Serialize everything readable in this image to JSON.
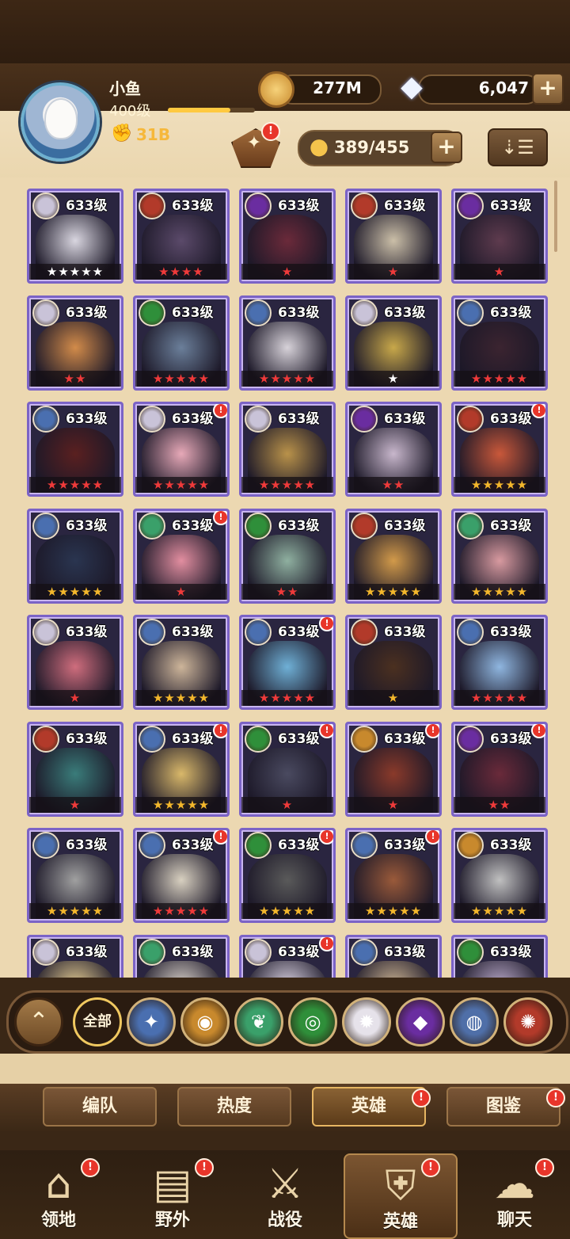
{
  "player": {
    "name": "小鱼",
    "level": "400级",
    "power": "31B"
  },
  "currency": {
    "gold": "277M",
    "gems": "6,047"
  },
  "hero_count": "389/455",
  "heroes": [
    {
      "level": "633级",
      "stars": "★★★★★",
      "star_color": "#ffffff",
      "faction_color": "#c9c3d8",
      "alert": false
    },
    {
      "level": "633级",
      "stars": "★★★★",
      "star_color": "#ef3a3a",
      "faction_color": "#b23a2a",
      "alert": false
    },
    {
      "level": "633级",
      "stars": "★",
      "star_color": "#ef3a3a",
      "faction_color": "#6a2da0",
      "alert": false
    },
    {
      "level": "633级",
      "stars": "★",
      "star_color": "#ef3a3a",
      "faction_color": "#b23a2a",
      "alert": false
    },
    {
      "level": "633级",
      "stars": "★",
      "star_color": "#ef3a3a",
      "faction_color": "#6a2da0",
      "alert": false
    },
    {
      "level": "633级",
      "stars": "★★",
      "star_color": "#ef3a3a",
      "faction_color": "#c9c3d8",
      "alert": false
    },
    {
      "level": "633级",
      "stars": "★★★★★",
      "star_color": "#ef3a3a",
      "faction_color": "#2f8f3a",
      "alert": false
    },
    {
      "level": "633级",
      "stars": "★★★★★",
      "star_color": "#ef3a3a",
      "faction_color": "#4a6fb0",
      "alert": false
    },
    {
      "level": "633级",
      "stars": "★",
      "star_color": "#ffffff",
      "faction_color": "#c9c3d8",
      "alert": false
    },
    {
      "level": "633级",
      "stars": "★★★★★",
      "star_color": "#ef3a3a",
      "faction_color": "#4a6fb0",
      "alert": false
    },
    {
      "level": "633级",
      "stars": "★★★★★",
      "star_color": "#ef3a3a",
      "faction_color": "#4a6fb0",
      "alert": false
    },
    {
      "level": "633级",
      "stars": "★★★★★",
      "star_color": "#ef3a3a",
      "faction_color": "#c9c3d8",
      "alert": true
    },
    {
      "level": "633级",
      "stars": "★★★★★",
      "star_color": "#ef3a3a",
      "faction_color": "#c9c3d8",
      "alert": false
    },
    {
      "level": "633级",
      "stars": "★★",
      "star_color": "#ef3a3a",
      "faction_color": "#6a2da0",
      "alert": false
    },
    {
      "level": "633级",
      "stars": "★★★★★",
      "star_color": "#f3b72c",
      "faction_color": "#b23a2a",
      "alert": true
    },
    {
      "level": "633级",
      "stars": "★★★★★",
      "star_color": "#f3b72c",
      "faction_color": "#4a6fb0",
      "alert": false
    },
    {
      "level": "633级",
      "stars": "★",
      "star_color": "#ef3a3a",
      "faction_color": "#3aa06a",
      "alert": true
    },
    {
      "level": "633级",
      "stars": "★★",
      "star_color": "#ef3a3a",
      "faction_color": "#2f8f3a",
      "alert": false
    },
    {
      "level": "633级",
      "stars": "★★★★★",
      "star_color": "#f3b72c",
      "faction_color": "#b23a2a",
      "alert": false
    },
    {
      "level": "633级",
      "stars": "★★★★★",
      "star_color": "#f3b72c",
      "faction_color": "#3aa06a",
      "alert": false
    },
    {
      "level": "633级",
      "stars": "★",
      "star_color": "#ef3a3a",
      "faction_color": "#c9c3d8",
      "alert": false
    },
    {
      "level": "633级",
      "stars": "★★★★★",
      "star_color": "#f3b72c",
      "faction_color": "#4a6fb0",
      "alert": false
    },
    {
      "level": "633级",
      "stars": "★★★★★",
      "star_color": "#ef3a3a",
      "faction_color": "#4a6fb0",
      "alert": true
    },
    {
      "level": "633级",
      "stars": "★",
      "star_color": "#f3b72c",
      "faction_color": "#b23a2a",
      "alert": false
    },
    {
      "level": "633级",
      "stars": "★★★★★",
      "star_color": "#ef3a3a",
      "faction_color": "#4a6fb0",
      "alert": false
    },
    {
      "level": "633级",
      "stars": "★",
      "star_color": "#ef3a3a",
      "faction_color": "#b23a2a",
      "alert": false
    },
    {
      "level": "633级",
      "stars": "★★★★★",
      "star_color": "#f3b72c",
      "faction_color": "#4a6fb0",
      "alert": true
    },
    {
      "level": "633级",
      "stars": "★",
      "star_color": "#ef3a3a",
      "faction_color": "#2f8f3a",
      "alert": true
    },
    {
      "level": "633级",
      "stars": "★",
      "star_color": "#ef3a3a",
      "faction_color": "#c8892d",
      "alert": true
    },
    {
      "level": "633级",
      "stars": "★★",
      "star_color": "#ef3a3a",
      "faction_color": "#6a2da0",
      "alert": true
    },
    {
      "level": "633级",
      "stars": "★★★★★",
      "star_color": "#f3b72c",
      "faction_color": "#4a6fb0",
      "alert": false
    },
    {
      "level": "633级",
      "stars": "★★★★★",
      "star_color": "#ef3a3a",
      "faction_color": "#4a6fb0",
      "alert": true
    },
    {
      "level": "633级",
      "stars": "★★★★★",
      "star_color": "#f3b72c",
      "faction_color": "#2f8f3a",
      "alert": true
    },
    {
      "level": "633级",
      "stars": "★★★★★",
      "star_color": "#f3b72c",
      "faction_color": "#4a6fb0",
      "alert": true
    },
    {
      "level": "633级",
      "stars": "★★★★★",
      "star_color": "#f3b72c",
      "faction_color": "#c8892d",
      "alert": false
    },
    {
      "level": "633级",
      "stars": "",
      "star_color": "#ef3a3a",
      "faction_color": "#c9c3d8",
      "alert": false
    },
    {
      "level": "633级",
      "stars": "",
      "star_color": "#ef3a3a",
      "faction_color": "#3aa06a",
      "alert": false
    },
    {
      "level": "633级",
      "stars": "",
      "star_color": "#ef3a3a",
      "faction_color": "#c9c3d8",
      "alert": true
    },
    {
      "level": "633级",
      "stars": "",
      "star_color": "#ef3a3a",
      "faction_color": "#4a6fb0",
      "alert": false
    },
    {
      "level": "633级",
      "stars": "",
      "star_color": "#ef3a3a",
      "faction_color": "#2f8f3a",
      "alert": false
    }
  ],
  "factions": {
    "all_label": "全部",
    "items": [
      {
        "name": "lightbearer-faction-icon",
        "color": "#4a6fb0",
        "glyph": "✦"
      },
      {
        "name": "mauler-faction-icon",
        "color": "#c8892d",
        "glyph": "◉"
      },
      {
        "name": "wilder-faction-icon",
        "color": "#3aa06a",
        "glyph": "❦"
      },
      {
        "name": "graveborn-faction-icon",
        "color": "#2f8f3a",
        "glyph": "◎"
      },
      {
        "name": "celestial-faction-icon",
        "color": "#e6e2ea",
        "glyph": "✹"
      },
      {
        "name": "hypogean-faction-icon",
        "color": "#6a2da0",
        "glyph": "◆"
      },
      {
        "name": "dimensional-faction-icon",
        "color": "#4f6fa8",
        "glyph": "◍"
      },
      {
        "name": "draconis-faction-icon",
        "color": "#b23a2a",
        "glyph": "✺"
      }
    ]
  },
  "tabs": [
    "编队",
    "热度",
    "英雄",
    "图鉴"
  ],
  "nav": [
    "领地",
    "野外",
    "战役",
    "英雄",
    "聊天"
  ]
}
